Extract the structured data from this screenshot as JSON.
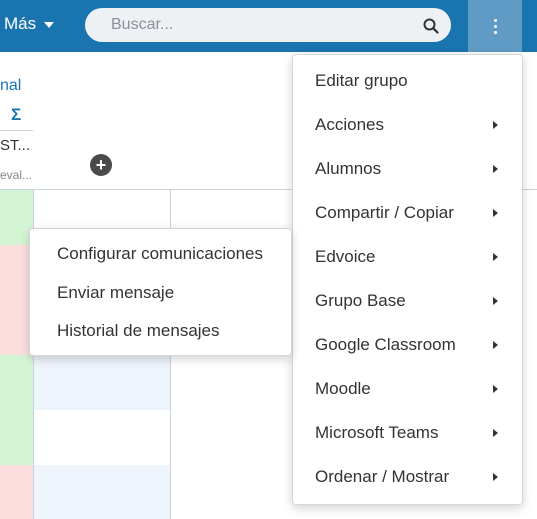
{
  "topbar": {
    "mas_label": "Más",
    "search_placeholder": "Buscar..."
  },
  "grid": {
    "column_link_label": "nal",
    "sum_symbol": "Σ",
    "column_abbr": "ST...",
    "column_eval": "eval...",
    "add_symbol": "+"
  },
  "colors": {
    "topbar": "#1a74b0",
    "kebab_active": "#5f9bc4",
    "cell_green": "#d4f5d4",
    "cell_red": "#fddede",
    "cell_blue": "#eef4fc"
  },
  "main_menu": {
    "items": [
      {
        "label": "Editar grupo",
        "has_submenu": false
      },
      {
        "label": "Acciones",
        "has_submenu": true
      },
      {
        "label": "Alumnos",
        "has_submenu": true
      },
      {
        "label": "Compartir / Copiar",
        "has_submenu": true
      },
      {
        "label": "Edvoice",
        "has_submenu": true
      },
      {
        "label": "Grupo Base",
        "has_submenu": true
      },
      {
        "label": "Google Classroom",
        "has_submenu": true
      },
      {
        "label": "Moodle",
        "has_submenu": true
      },
      {
        "label": "Microsoft Teams",
        "has_submenu": true
      },
      {
        "label": "Ordenar / Mostrar",
        "has_submenu": true
      }
    ]
  },
  "sub_menu": {
    "items": [
      {
        "label": "Configurar comunicaciones"
      },
      {
        "label": "Enviar mensaje"
      },
      {
        "label": "Historial de mensajes"
      }
    ]
  }
}
